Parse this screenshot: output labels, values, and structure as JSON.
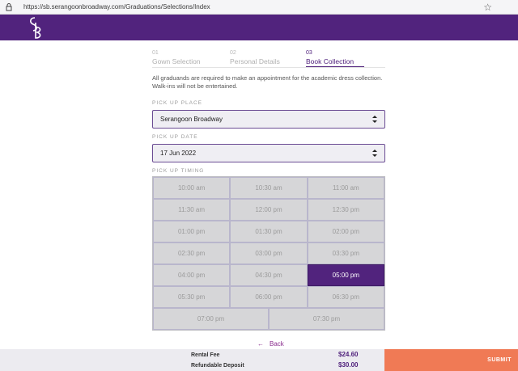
{
  "browser": {
    "url": "https://sb.serangoonbroadway.com/Graduations/Selections/Index"
  },
  "steps": [
    {
      "num": "01",
      "label": "Gown Selection"
    },
    {
      "num": "02",
      "label": "Personal Details"
    },
    {
      "num": "03",
      "label": "Book Collection"
    }
  ],
  "notice": "All graduands are required to make an appointment for the academic dress collection. Walk-ins will not be entertained.",
  "pickup_place": {
    "label": "PICK UP PLACE",
    "value": "Serangoon Broadway"
  },
  "pickup_date": {
    "label": "PICK UP DATE",
    "value": "17 Jun 2022"
  },
  "pickup_timing": {
    "label": "PICK UP TIMING",
    "slots": [
      "10:00 am",
      "10:30 am",
      "11:00 am",
      "11:30 am",
      "12:00 pm",
      "12:30 pm",
      "01:00 pm",
      "01:30 pm",
      "02:00 pm",
      "02:30 pm",
      "03:00 pm",
      "03:30 pm",
      "04:00 pm",
      "04:30 pm",
      "05:00 pm",
      "05:30 pm",
      "06:00 pm",
      "06:30 pm",
      "07:00 pm",
      "07:30 pm"
    ],
    "selected": "05:00 pm"
  },
  "back_label": "Back",
  "footer": {
    "rental_fee_label": "Rental Fee",
    "rental_fee_value": "$24.60",
    "deposit_label": "Refundable Deposit",
    "deposit_value": "$30.00",
    "submit_label": "SUBMIT"
  },
  "colors": {
    "brand": "#51237d",
    "submit": "#f07a55",
    "link": "#8b2f8f"
  }
}
